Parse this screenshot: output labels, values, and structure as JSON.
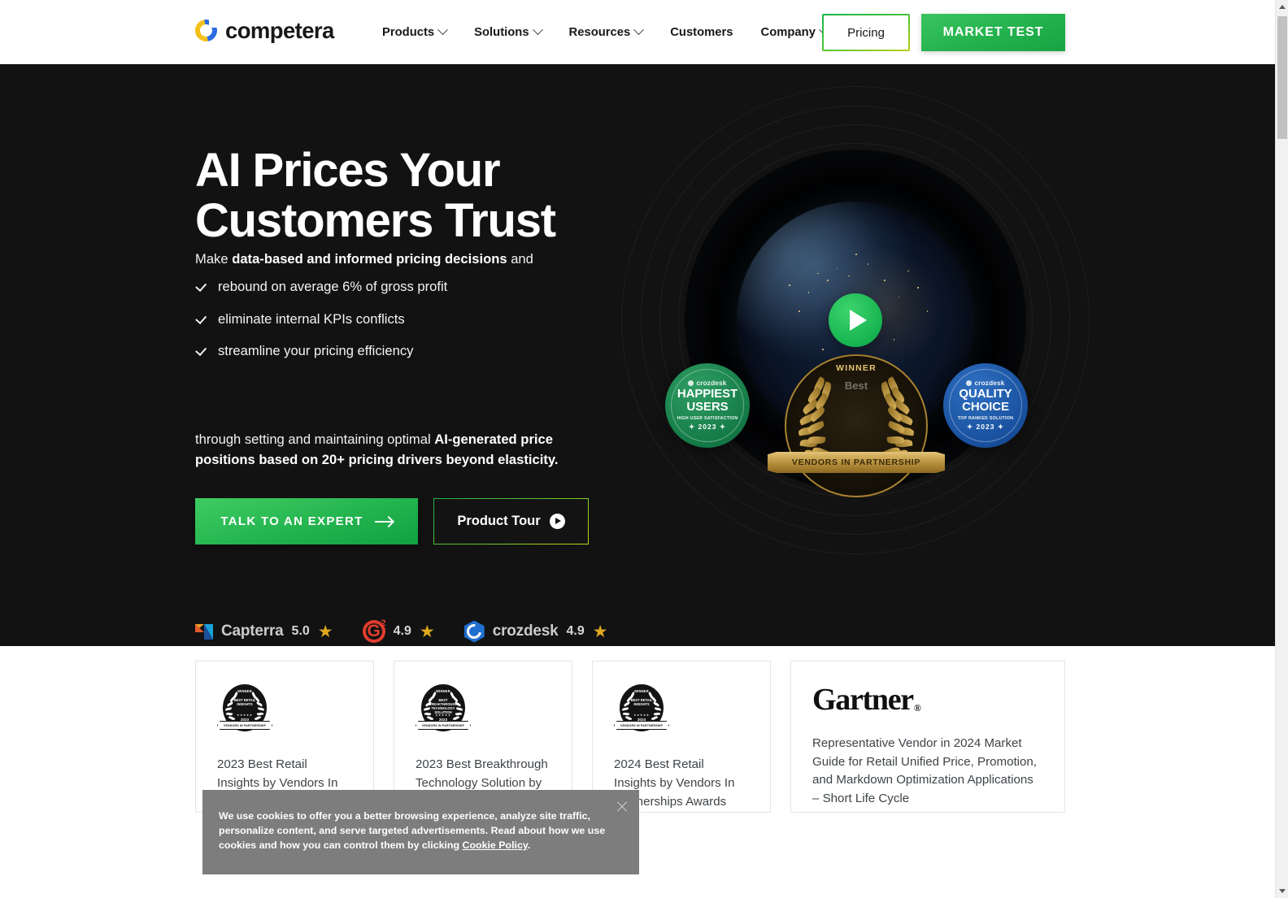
{
  "brand": {
    "name": "competera",
    "logo_icon": "competera-ring-logo",
    "colors": {
      "blue": "#2b6ce4",
      "yellow": "#f3c11b"
    }
  },
  "header": {
    "nav": [
      {
        "label": "Products",
        "has_dropdown": true
      },
      {
        "label": "Solutions",
        "has_dropdown": true
      },
      {
        "label": "Resources",
        "has_dropdown": true
      },
      {
        "label": "Customers",
        "has_dropdown": false
      },
      {
        "label": "Company",
        "has_dropdown": true
      }
    ],
    "pricing_label": "Pricing",
    "market_test_label": "MARKET TEST"
  },
  "hero": {
    "title_line1": "AI Prices Your",
    "title_line2": "Customers Trust",
    "lead_prefix": "Make ",
    "lead_bold": "data-based and informed pricing decisions",
    "lead_suffix": " and",
    "bullets": [
      "rebound on average 6% of gross profit",
      "eliminate internal KPIs conflicts",
      "streamline your pricing efficiency"
    ],
    "foot_prefix": "through setting and maintaining optimal ",
    "foot_bold": "AI-generated price positions based on 20+ pricing drivers beyond elasticity.",
    "cta_primary": "TALK TO AN EXPERT",
    "cta_secondary": "Product Tour",
    "ratings": [
      {
        "name": "Capterra",
        "score": "5.0",
        "icon": "capterra-logo"
      },
      {
        "name": "",
        "score": "4.9",
        "icon": "g2-logo"
      },
      {
        "name": "crozdesk",
        "score": "4.9",
        "icon": "crozdesk-logo"
      }
    ],
    "media": {
      "play_icon": "play-button-icon",
      "badge_left": {
        "source": "crozdesk",
        "title_line1": "HAPPIEST",
        "title_line2": "USERS",
        "subtitle": "HIGH USER SATISFACTION",
        "year": "2023",
        "color": "#147a47"
      },
      "badge_right": {
        "source": "crozdesk",
        "title_line1": "QUALITY",
        "title_line2": "CHOICE",
        "subtitle": "TOP RANKED SOLUTION",
        "year": "2023",
        "color": "#18509e"
      },
      "center_award": {
        "top_word": "WINNER",
        "mid_word": "Best",
        "ribbon": "VENDORS IN PARTNERSHIP"
      }
    }
  },
  "awards": {
    "cards": [
      {
        "badge": {
          "winner": "WINNER",
          "title": "BEST RETAIL INSIGHTS",
          "stars": "★★★★★",
          "year": "2023",
          "band": "VENDORS IN PARTNERSHIP"
        },
        "text": "2023 Best Retail Insights by Vendors In Partnerships Awards"
      },
      {
        "badge": {
          "winner": "WINNER",
          "title": "BEST BREAKTHROUGH TECHNOLOGY SOLUTION",
          "stars": "★★★★★",
          "year": "2023",
          "band": "VENDORS IN PARTNERSHIP"
        },
        "text": "2023 Best Breakthrough Technology Solution by Vendors in Partnerships Awards"
      },
      {
        "badge": {
          "winner": "WINNER",
          "title": "BEST RETAIL INSIGHTS",
          "stars": "★★★★★",
          "year": "2024",
          "band": "VENDORS IN PARTNERSHIP"
        },
        "text": "2024 Best Retail Insights by Vendors In Partnerships Awards"
      }
    ],
    "gartner": {
      "logo": "Gartner",
      "registered": "®",
      "text": "Representative Vendor in 2024 Market Guide for Retail Unified Price, Promotion, and Markdown Optimization Applications – Short Life Cycle"
    }
  },
  "cookie": {
    "text_before_link": "We use cookies to offer you a better browsing experience, analyze site traffic, personalize content, and serve targeted advertisements. Read about how we use cookies and how you can control them by clicking ",
    "link_label": "Cookie Policy",
    "text_after_link": ".",
    "close_icon": "close-icon"
  }
}
